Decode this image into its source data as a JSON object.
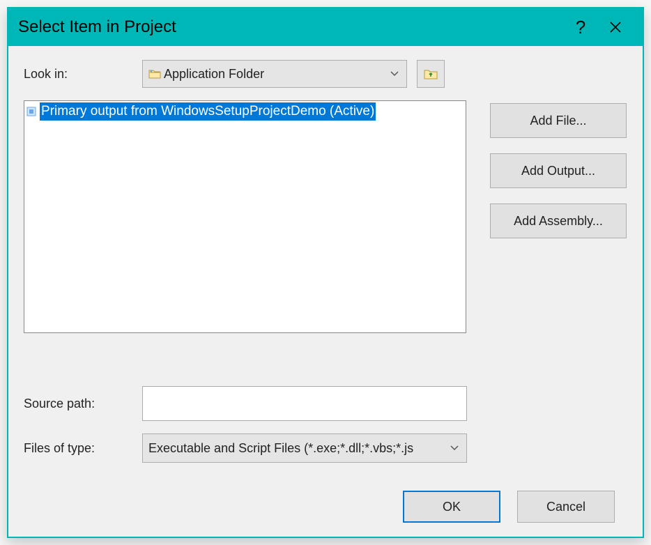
{
  "title": "Select Item in Project",
  "labels": {
    "look_in": "Look in:",
    "source_path": "Source path:",
    "files_of_type": "Files of type:"
  },
  "look_in_value": "Application Folder",
  "list": {
    "items": [
      {
        "text": "Primary output from WindowsSetupProjectDemo (Active)"
      }
    ]
  },
  "source_path_value": "",
  "files_of_type_value": "Executable and Script Files (*.exe;*.dll;*.vbs;*.js",
  "buttons": {
    "add_file": "Add File...",
    "add_output": "Add Output...",
    "add_assembly": "Add Assembly...",
    "ok": "OK",
    "cancel": "Cancel"
  }
}
